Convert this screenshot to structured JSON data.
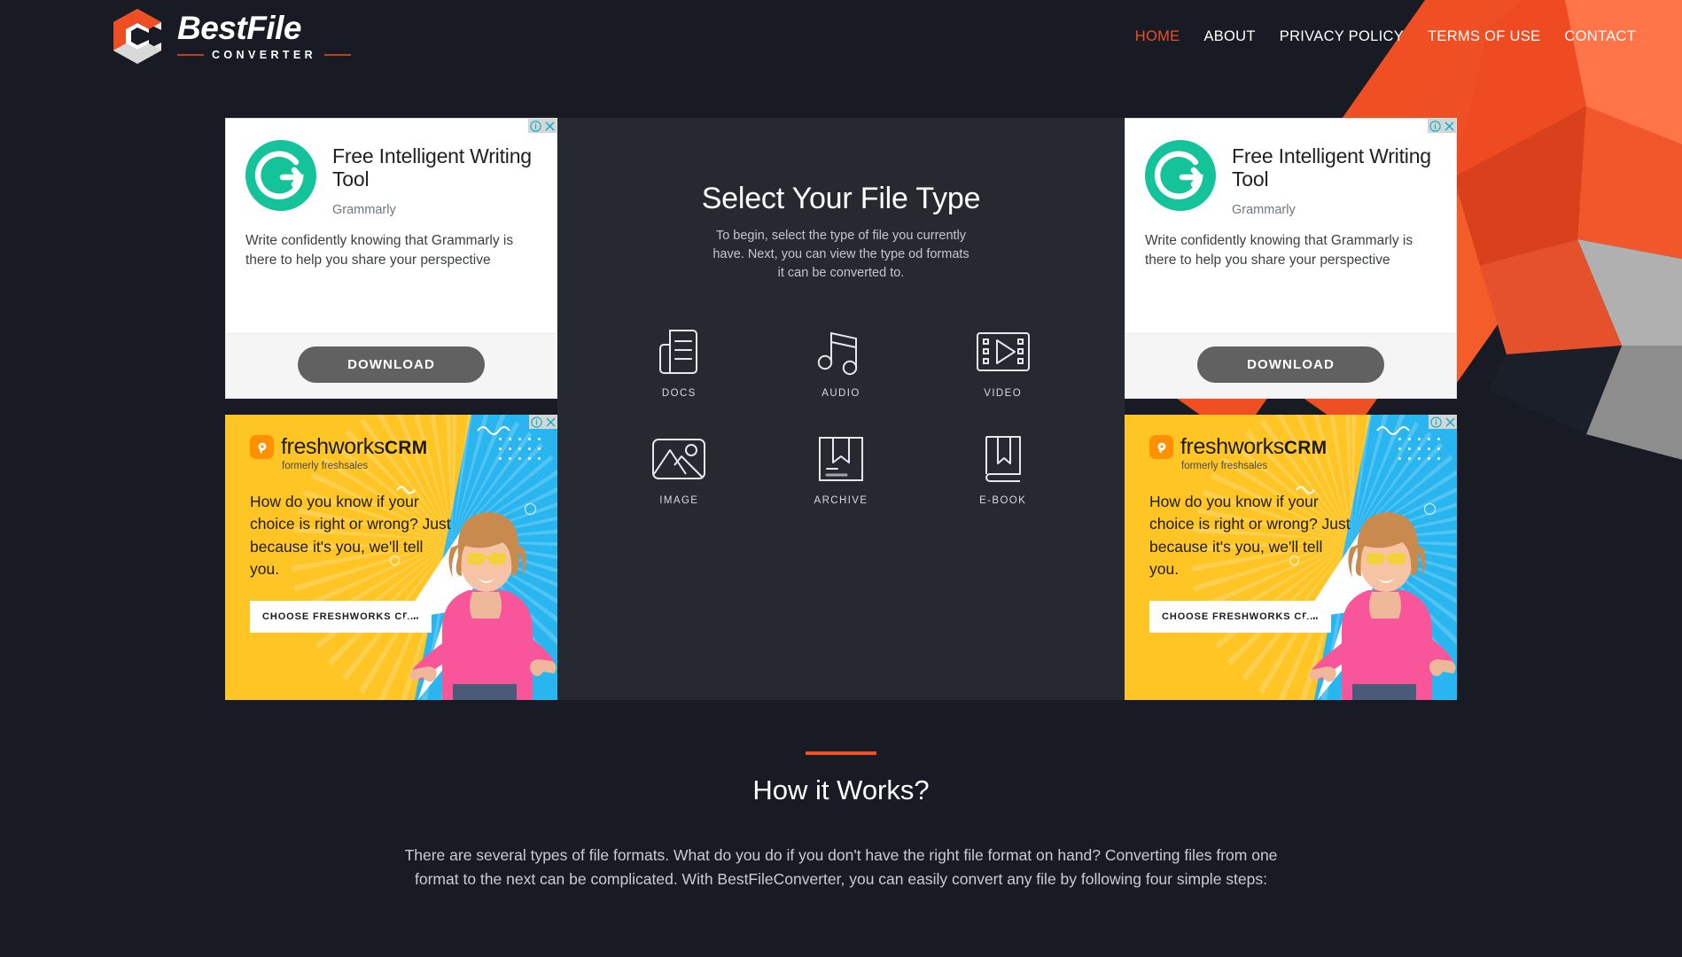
{
  "brand": {
    "name": "BestFile",
    "subtitle": "CONVERTER",
    "accent_color": "#f04e23",
    "logo_icon": "hexagon-c-logo-icon"
  },
  "nav": {
    "items": [
      {
        "label": "HOME",
        "active": true
      },
      {
        "label": "ABOUT",
        "active": false
      },
      {
        "label": "PRIVACY POLICY",
        "active": false
      },
      {
        "label": "TERMS OF USE",
        "active": false
      },
      {
        "label": "CONTACT",
        "active": false
      }
    ]
  },
  "hero": {
    "title": "Select Your File Type",
    "subtitle": "To begin, select the type of file you currently have. Next, you can view the type od formats it can be converted to.",
    "file_types": [
      {
        "label": "DOCS",
        "icon": "document-icon"
      },
      {
        "label": "AUDIO",
        "icon": "music-note-icon"
      },
      {
        "label": "VIDEO",
        "icon": "film-play-icon"
      },
      {
        "label": "IMAGE",
        "icon": "picture-icon"
      },
      {
        "label": "ARCHIVE",
        "icon": "archive-box-icon"
      },
      {
        "label": "E-BOOK",
        "icon": "book-icon"
      }
    ]
  },
  "ads": {
    "grammarly": {
      "title": "Free Intelligent Writing Tool",
      "brand": "Grammarly",
      "body": "Write confidently knowing that Grammarly is there to help you share your perspective",
      "cta": "DOWNLOAD",
      "info_icon": "ad-info-icon",
      "close_icon": "ad-close-icon",
      "logo_icon": "grammarly-g-icon",
      "logo_color": "#15c39a"
    },
    "freshworks": {
      "name": "freshworks",
      "name_bold": "CRM",
      "tagline": "formerly freshsales",
      "copy": "How do you know if your choice is right or wrong? Just because it's you, we'll tell you.",
      "cta": "CHOOSE FRESHWORKS CRM",
      "info_icon": "ad-info-icon",
      "close_icon": "ad-close-icon",
      "logo_icon": "freshworks-badge-icon",
      "bg_left_color": "#ffc525",
      "bg_right_color": "#29b6f0"
    }
  },
  "how_it_works": {
    "heading": "How it Works?",
    "body": "There are several types of file formats. What do you do if you don't have the right file format on hand? Converting files from one format to the next can be complicated. With BestFileConverter, you can easily convert any file by following four simple steps:"
  }
}
